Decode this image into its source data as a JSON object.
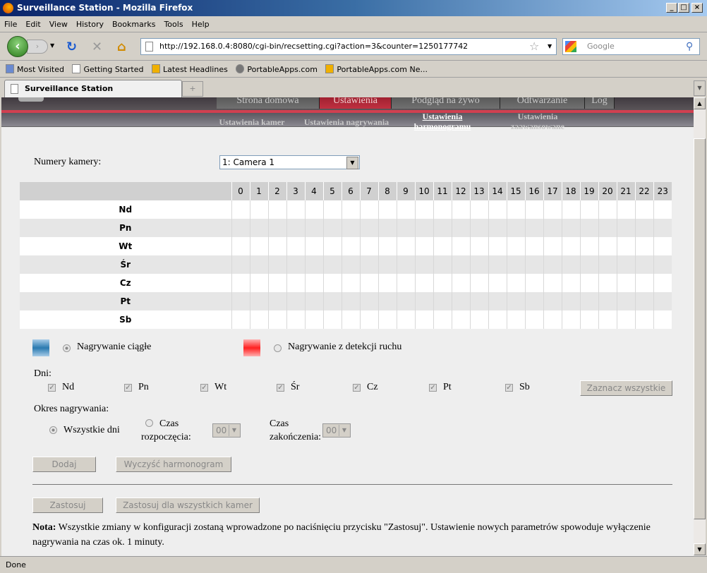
{
  "window": {
    "title": "Surveillance Station - Mozilla Firefox"
  },
  "menu": [
    "File",
    "Edit",
    "View",
    "History",
    "Bookmarks",
    "Tools",
    "Help"
  ],
  "address": {
    "url": "http://192.168.0.4:8080/cgi-bin/recsetting.cgi?action=3&counter=1250177742"
  },
  "search": {
    "placeholder": "Google"
  },
  "bookmarks": [
    "Most Visited",
    "Getting Started",
    "Latest Headlines",
    "PortableApps.com",
    "PortableApps.com Ne..."
  ],
  "tab": {
    "title": "Surveillance Station"
  },
  "topnav": [
    "Strona domowa",
    "Ustawienia",
    "Podgląd na żywo",
    "Odtwarzanie",
    "Log"
  ],
  "subnav": [
    "Ustawienia kamer",
    "Ustawienia nagrywania",
    "Ustawienia harmonogramu",
    "Ustawienia zaawansowane"
  ],
  "camera": {
    "label": "Numery kamery:",
    "value": "1: Camera 1"
  },
  "schedule": {
    "hours": [
      "0",
      "1",
      "2",
      "3",
      "4",
      "5",
      "6",
      "7",
      "8",
      "9",
      "10",
      "11",
      "12",
      "13",
      "14",
      "15",
      "16",
      "17",
      "18",
      "19",
      "20",
      "21",
      "22",
      "23"
    ],
    "days": [
      "Nd",
      "Pn",
      "Wt",
      "Śr",
      "Cz",
      "Pt",
      "Sb"
    ]
  },
  "legend": {
    "continuous": "Nagrywanie ciągłe",
    "motion": "Nagrywanie z detekcji ruchu",
    "continuous_color": "#2a7ab0",
    "motion_color": "#ff3030"
  },
  "days_section": {
    "label": "Dni:",
    "days": [
      "Nd",
      "Pn",
      "Wt",
      "Śr",
      "Cz",
      "Pt",
      "Sb"
    ],
    "select_all": "Zaznacz wszystkie"
  },
  "period": {
    "label": "Okres nagrywania:",
    "all_days": "Wszystkie dni",
    "start_label1": "Czas",
    "start_label2": "rozpoczęcia:",
    "start_value": "00",
    "end_label1": "Czas",
    "end_label2": "zakończenia:",
    "end_value": "00"
  },
  "buttons": {
    "add": "Dodaj",
    "clear": "Wyczyść harmonogram",
    "apply": "Zastosuj",
    "apply_all": "Zastosuj dla wszystkich kamer"
  },
  "note": {
    "bold": "Nota:",
    "text": " Wszystkie zmiany w konfiguracji zostaną wprowadzone po naciśnięciu przycisku \"Zastosuj\". Ustawienie nowych parametrów spowoduje wyłączenie nagrywania na czas ok. 1 minuty."
  },
  "status": "Done"
}
